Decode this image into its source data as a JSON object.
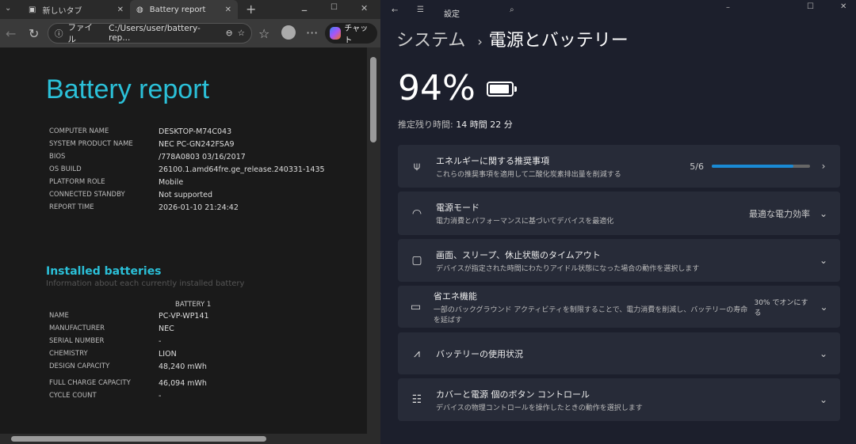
{
  "browser": {
    "tabs": [
      {
        "label": "新しいタブ",
        "icon": "new-tab-icon"
      },
      {
        "label": "Battery report",
        "icon": "globe-icon"
      }
    ],
    "address_prefix": "ファイル",
    "address": "C:/Users/user/battery-rep...",
    "chat_label": "チャット"
  },
  "report": {
    "title": "Battery report",
    "system": [
      {
        "k": "COMPUTER NAME",
        "v": "DESKTOP-M74C043"
      },
      {
        "k": "SYSTEM PRODUCT NAME",
        "v": "NEC PC-GN242FSA9"
      },
      {
        "k": "BIOS",
        "v": "/778A0803 03/16/2017"
      },
      {
        "k": "OS BUILD",
        "v": "26100.1.amd64fre.ge_release.240331-1435"
      },
      {
        "k": "PLATFORM ROLE",
        "v": "Mobile"
      },
      {
        "k": "CONNECTED STANDBY",
        "v": "Not supported"
      },
      {
        "k": "REPORT TIME",
        "v": "2026-01-10  21:24:42"
      }
    ],
    "batteries_title": "Installed batteries",
    "batteries_sub": "Information about each currently installed battery",
    "battery_header": "BATTERY 1",
    "battery": [
      {
        "k": "NAME",
        "v": "PC-VP-WP141"
      },
      {
        "k": "MANUFACTURER",
        "v": "NEC"
      },
      {
        "k": "SERIAL NUMBER",
        "v": "-"
      },
      {
        "k": "CHEMISTRY",
        "v": "LION"
      },
      {
        "k": "DESIGN CAPACITY",
        "v": "48,240 mWh"
      },
      {
        "k": "FULL CHARGE CAPACITY",
        "v": "46,094 mWh"
      },
      {
        "k": "CYCLE COUNT",
        "v": "-"
      }
    ]
  },
  "settings": {
    "app_title": "設定",
    "crumb_parent": "システム",
    "crumb_sep": "›",
    "crumb_current": "電源とバッテリー",
    "percent": "94%",
    "battery_level": 0.94,
    "remain_label": "推定残り時間:",
    "remain_value": "14 時間 22 分",
    "accent": "#1a8ad4",
    "cards": [
      {
        "icon": "leaf-icon",
        "title": "エネルギーに関する推奨事項",
        "sub": "これらの推奨事項を適用して二酸化炭素排出量を削減する",
        "value": "5/6",
        "progress": 0.83,
        "chev": "›"
      },
      {
        "icon": "power-mode-icon",
        "title": "電源モード",
        "sub": "電力消費とパフォーマンスに基づいてデバイスを最適化",
        "value": "最適な電力効率",
        "chev": "⌄"
      },
      {
        "icon": "screen-sleep-icon",
        "title": "画面、スリープ、休止状態のタイムアウト",
        "sub": "デバイスが指定された時間にわたりアイドル状態になった場合の動作を選択します",
        "chev": "⌄"
      },
      {
        "icon": "energy-saver-icon",
        "title": "省エネ機能",
        "sub": "一部のバックグラウンド アクティビティを制限することで、電力消費を削減し、バッテリーの寿命を延ばす",
        "value": "30% でオンにする",
        "chev": "⌄"
      },
      {
        "icon": "usage-chart-icon",
        "title": "バッテリーの使用状況",
        "chev": "⌄"
      },
      {
        "icon": "buttons-list-icon",
        "title": "カバーと電源 個のボタン コントロール",
        "sub": "デバイスの物理コントロールを操作したときの動作を選択します",
        "chev": "⌄"
      }
    ]
  }
}
